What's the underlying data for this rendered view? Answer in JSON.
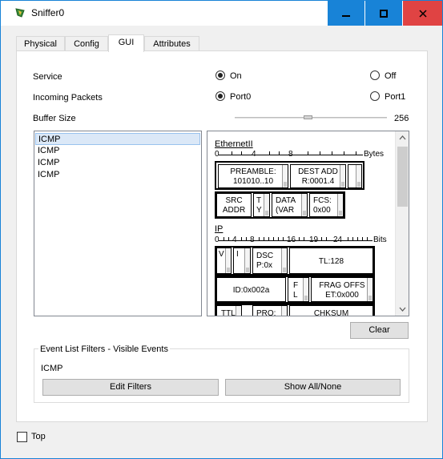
{
  "window": {
    "title": "Sniffer0",
    "accent": "#1883d7",
    "close_color": "#e04343"
  },
  "tabs": [
    {
      "label": "Physical",
      "active": false
    },
    {
      "label": "Config",
      "active": false
    },
    {
      "label": "GUI",
      "active": true
    },
    {
      "label": "Attributes",
      "active": false
    }
  ],
  "service": {
    "label": "Service",
    "options": [
      {
        "label": "On",
        "checked": true
      },
      {
        "label": "Off",
        "checked": false
      }
    ]
  },
  "incoming": {
    "label": "Incoming Packets",
    "options": [
      {
        "label": "Port0",
        "checked": true
      },
      {
        "label": "Port1",
        "checked": false
      }
    ]
  },
  "buffer": {
    "label": "Buffer Size",
    "value": "256",
    "level_fraction": 0.5
  },
  "event_list": {
    "items": [
      "ICMP",
      "ICMP",
      "ICMP",
      "ICMP"
    ],
    "selected_index": 0
  },
  "pdu": {
    "ethernet": {
      "title": "EthernetII",
      "ruler": {
        "marks": [
          "0",
          "4",
          "8"
        ],
        "unit": "Bytes"
      },
      "fields": {
        "preamble": [
          "PREAMBLE:",
          "101010..10"
        ],
        "dest": [
          "DEST ADD",
          "R:0001.4"
        ],
        "src": [
          "SRC",
          "ADDR"
        ],
        "type": [
          "T",
          "Y"
        ],
        "data": [
          "DATA",
          "(VAR"
        ],
        "fcs": [
          "FCS:",
          "0x00"
        ]
      }
    },
    "ip": {
      "title": "IP",
      "ruler": {
        "marks": [
          "0",
          "4",
          "8",
          "16",
          "19",
          "24"
        ],
        "unit": "Bits"
      },
      "fields": {
        "ver": [
          "V",
          ""
        ],
        "ihl": [
          "I",
          ""
        ],
        "dscp": [
          "DSC",
          "P:0x"
        ],
        "tl": [
          "TL:128"
        ],
        "id": [
          "ID:0x002a"
        ],
        "flags": [
          "F",
          "L"
        ],
        "frag": [
          "FRAG OFFS",
          "ET:0x000"
        ],
        "ttl": [
          "TTL:"
        ],
        "proto": [
          "PRO:"
        ],
        "chksum": [
          "CHKSUM"
        ]
      }
    }
  },
  "buttons": {
    "clear": "Clear",
    "edit_filters": "Edit Filters",
    "show_all": "Show All/None"
  },
  "filters": {
    "group_title": "Event List Filters - Visible Events",
    "visible": "ICMP"
  },
  "top_checkbox": {
    "label": "Top",
    "checked": false
  }
}
